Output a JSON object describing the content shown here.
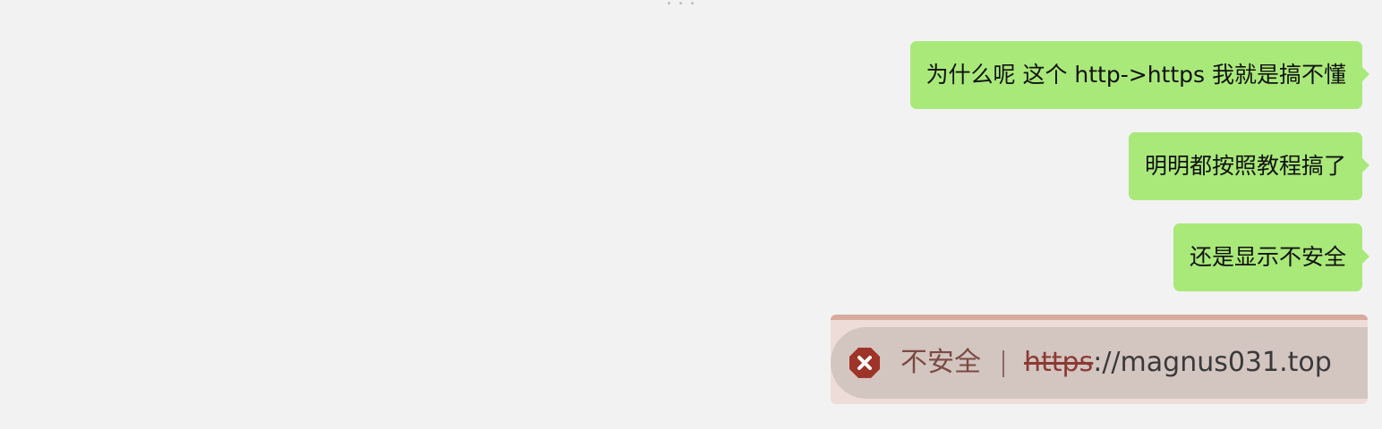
{
  "header": {
    "fragment": "..."
  },
  "messages": [
    {
      "text": "为什么呢 这个 http->https 我就是搞不懂"
    },
    {
      "text": "明明都按照教程搞了"
    },
    {
      "text": "还是显示不安全"
    }
  ],
  "image_message": {
    "icon": "warning-icon",
    "status_label": "不安全",
    "url_scheme": "https",
    "url_rest": "://magnus031.top"
  },
  "colors": {
    "bubble_green": "#a9e97a",
    "background": "#f2f2f2",
    "warning_red": "#9e3328"
  }
}
